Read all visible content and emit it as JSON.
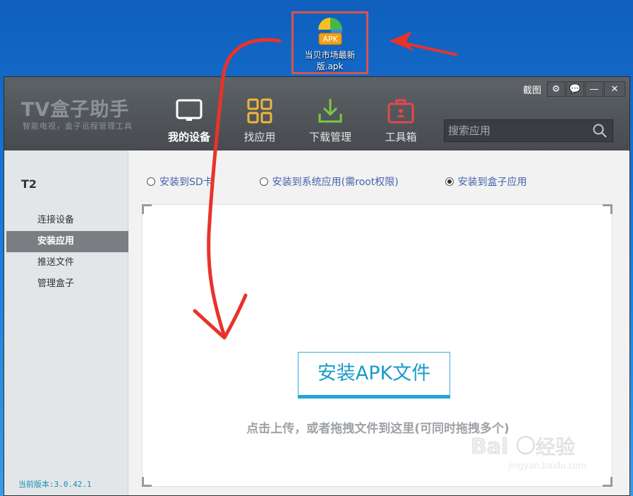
{
  "desktop": {
    "icon_badge": "APK",
    "icon_label": "当贝市场最新版.apk"
  },
  "app": {
    "logo_title": "TV盒子助手",
    "logo_subtitle": "智能电视，盒子远程管理工具",
    "nav": [
      {
        "label": "我的设备",
        "icon": "tv-icon"
      },
      {
        "label": "找应用",
        "icon": "grid-icon"
      },
      {
        "label": "下载管理",
        "icon": "download-icon"
      },
      {
        "label": "工具箱",
        "icon": "toolbox-icon"
      }
    ],
    "window_controls": {
      "screenshot_label": "截图",
      "settings": "⚙",
      "feedback": "💬",
      "minimize": "—",
      "close": "✕"
    },
    "search_placeholder": "搜索应用"
  },
  "sidebar": {
    "device_name": "T2",
    "items": [
      "连接设备",
      "安装应用",
      "推送文件",
      "管理盒子"
    ],
    "active_index": 1,
    "version": "当前版本:3.0.42.1"
  },
  "content": {
    "options": [
      {
        "label": "安装到SD卡",
        "selected": false
      },
      {
        "label": "安装到系统应用(需root权限)",
        "selected": false
      },
      {
        "label": "安装到盒子应用",
        "selected": true
      }
    ],
    "install_button": "安装APK文件",
    "hint": "点击上传，或者拖拽文件到这里(可同时拖拽多个)"
  },
  "watermark": {
    "logo": "Baidu经验",
    "url": "jingyan.baidu.com"
  },
  "colors": {
    "annotation": "#e8332b",
    "accent": "#1da6d6"
  }
}
